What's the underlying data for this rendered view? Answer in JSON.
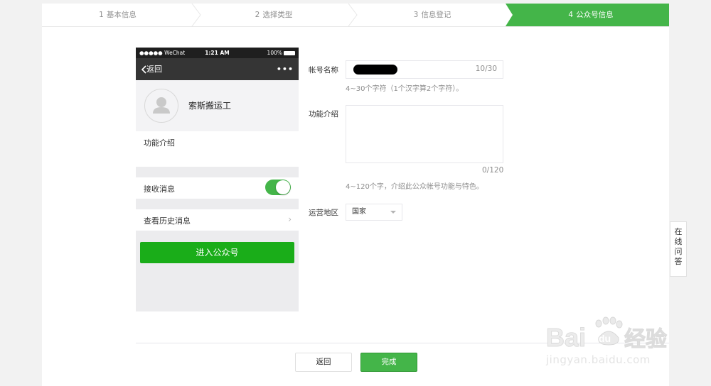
{
  "stepper": {
    "steps": [
      {
        "num": "1",
        "label": "基本信息"
      },
      {
        "num": "2",
        "label": "选择类型"
      },
      {
        "num": "3",
        "label": "信息登记"
      },
      {
        "num": "4",
        "label": "公众号信息"
      }
    ],
    "active_step": 4
  },
  "preview": {
    "status_carrier": "●●●●● WeChat",
    "status_time": "1:21 AM",
    "status_battery": "100%",
    "back_label": "返回",
    "more_label": "•••",
    "profile_name": "索斯搬运工",
    "intro_label": "功能介绍",
    "receive_label": "接收消息",
    "receive_on": true,
    "history_label": "查看历史消息",
    "enter_button": "进入公众号"
  },
  "form": {
    "name_label": "帐号名称",
    "name_counter": "10/30",
    "name_hint": "4~30个字符（1个汉字算2个字符）。",
    "intro_label": "功能介绍",
    "intro_value": "",
    "intro_counter": "0/120",
    "intro_hint": "4~120个字，介绍此公众帐号功能与特色。",
    "region_label": "运营地区",
    "region_value": "国家"
  },
  "footer": {
    "back_button": "返回",
    "done_button": "完成"
  },
  "side_tab": {
    "chars": [
      "在",
      "线",
      "问",
      "答"
    ]
  },
  "watermark": {
    "logo_text": "Bai du 经验",
    "url": "jingyan.baidu.com"
  },
  "colors": {
    "accent_green": "#44b549",
    "button_green": "#1aad19",
    "nav_dark": "#353535"
  }
}
